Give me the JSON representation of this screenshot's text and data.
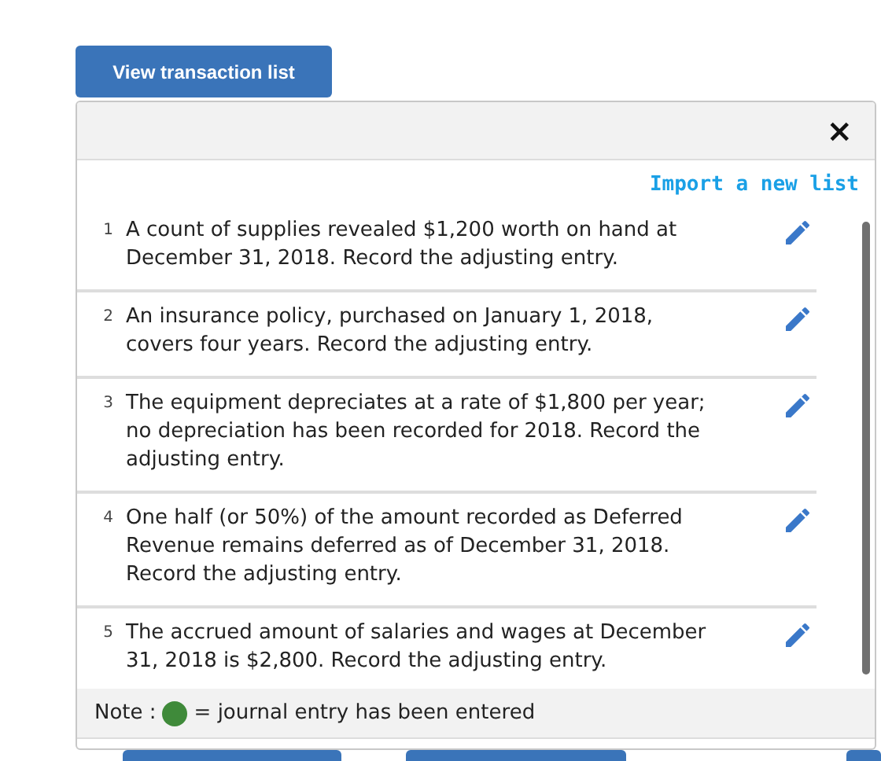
{
  "toggle_button": {
    "label": "View transaction list"
  },
  "panel": {
    "close": "×",
    "import_link": "Import a new list",
    "transactions": [
      {
        "number": "1",
        "text": "A count of supplies revealed $1,200 worth on hand at December 31, 2018. Record the adjusting entry."
      },
      {
        "number": "2",
        "text": "An insurance policy, purchased on January 1, 2018, covers four years. Record the adjusting entry."
      },
      {
        "number": "3",
        "text": "The equipment depreciates at a rate of $1,800 per year; no depreciation has been recorded for 2018. Record the adjusting entry."
      },
      {
        "number": "4",
        "text": "One half (or 50%) of the amount recorded as Deferred Revenue remains deferred as of December 31, 2018. Record the adjusting entry."
      },
      {
        "number": "5",
        "text": "The accrued amount of salaries and wages at December 31, 2018 is $2,800. Record the adjusting entry."
      }
    ],
    "note": {
      "prefix": "Note :",
      "suffix": "= journal entry has been entered"
    }
  }
}
